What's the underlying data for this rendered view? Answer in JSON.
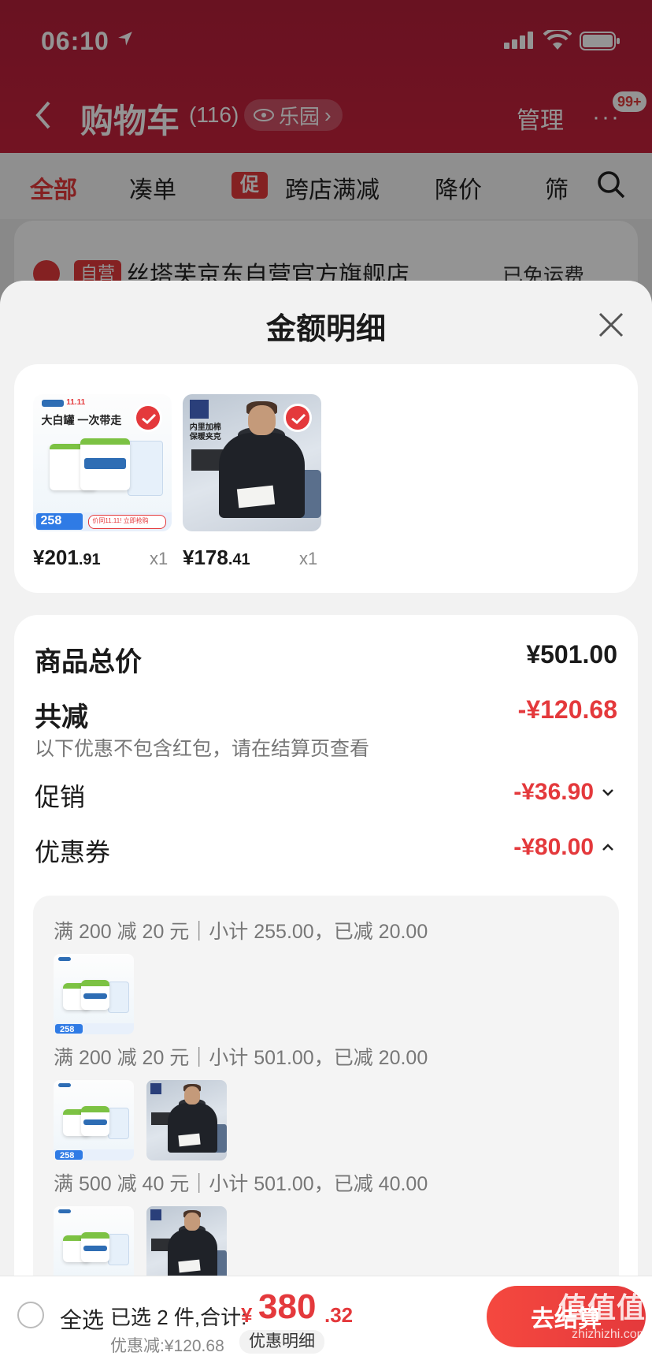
{
  "status_bar": {
    "time": "06:10"
  },
  "nav": {
    "title": "购物车",
    "count": "(116)",
    "pill_label": "乐园",
    "manage": "管理",
    "more": "···",
    "badge": "99+"
  },
  "tabs": [
    {
      "label": "全部",
      "active": true
    },
    {
      "label": "凑单",
      "active": false
    },
    {
      "label": "促",
      "active": false
    },
    {
      "label": "跨店满减",
      "active": false
    },
    {
      "label": "降价",
      "active": false
    },
    {
      "label": "筛",
      "active": false
    }
  ],
  "store": {
    "tag": "自营",
    "name": "丝塔芙京东自营官方旗舰店",
    "shipping": "已免运费"
  },
  "sheet": {
    "title": "金额明细",
    "products": [
      {
        "icon": "cetaphil-cream-product-image",
        "price_int": "¥201",
        "price_dec": ".91",
        "qty": "x1",
        "headline": "大白罐 一次带走",
        "badge_number": "258",
        "promo": "价同11.11! 立即抢购",
        "event": "11.11"
      },
      {
        "icon": "down-jacket-product-image",
        "price_int": "¥178",
        "price_dec": ".41",
        "qty": "x1",
        "line1": "内里加棉",
        "line2": "保暖夹克"
      }
    ],
    "details": {
      "total_label": "商品总价",
      "total_value": "¥501.00",
      "discount_label": "共减",
      "discount_value": "-¥120.68",
      "discount_note": "以下优惠不包含红包，请在结算页查看",
      "promo_label": "促销",
      "promo_value": "-¥36.90",
      "coupon_label": "优惠券",
      "coupon_value": "-¥80.00"
    },
    "coupons": [
      {
        "text": "满 200 减 20 元｜小计 255.00，已减 20.00",
        "items": [
          "cetaphil"
        ]
      },
      {
        "text": "满 200 减 20 元｜小计 501.00，已减 20.00",
        "items": [
          "cetaphil",
          "jacket"
        ]
      },
      {
        "text": "满 500 减 40 元｜小计 501.00，已减 40.00",
        "items": [
          "cetaphil",
          "jacket"
        ]
      }
    ]
  },
  "bottom": {
    "select_all": "全选",
    "selected_text": "已选 2 件,合计:",
    "currency": "¥",
    "amount_int": "380",
    "amount_dec": ".32",
    "discount_text": "优惠减:¥120.68",
    "detail_link": "优惠明细",
    "checkout": "去结算"
  },
  "watermark": {
    "main": "值值值",
    "sub": "zhizhizhi.com"
  },
  "colors": {
    "accent": "#e4393c",
    "topbar": "#c6223c"
  }
}
